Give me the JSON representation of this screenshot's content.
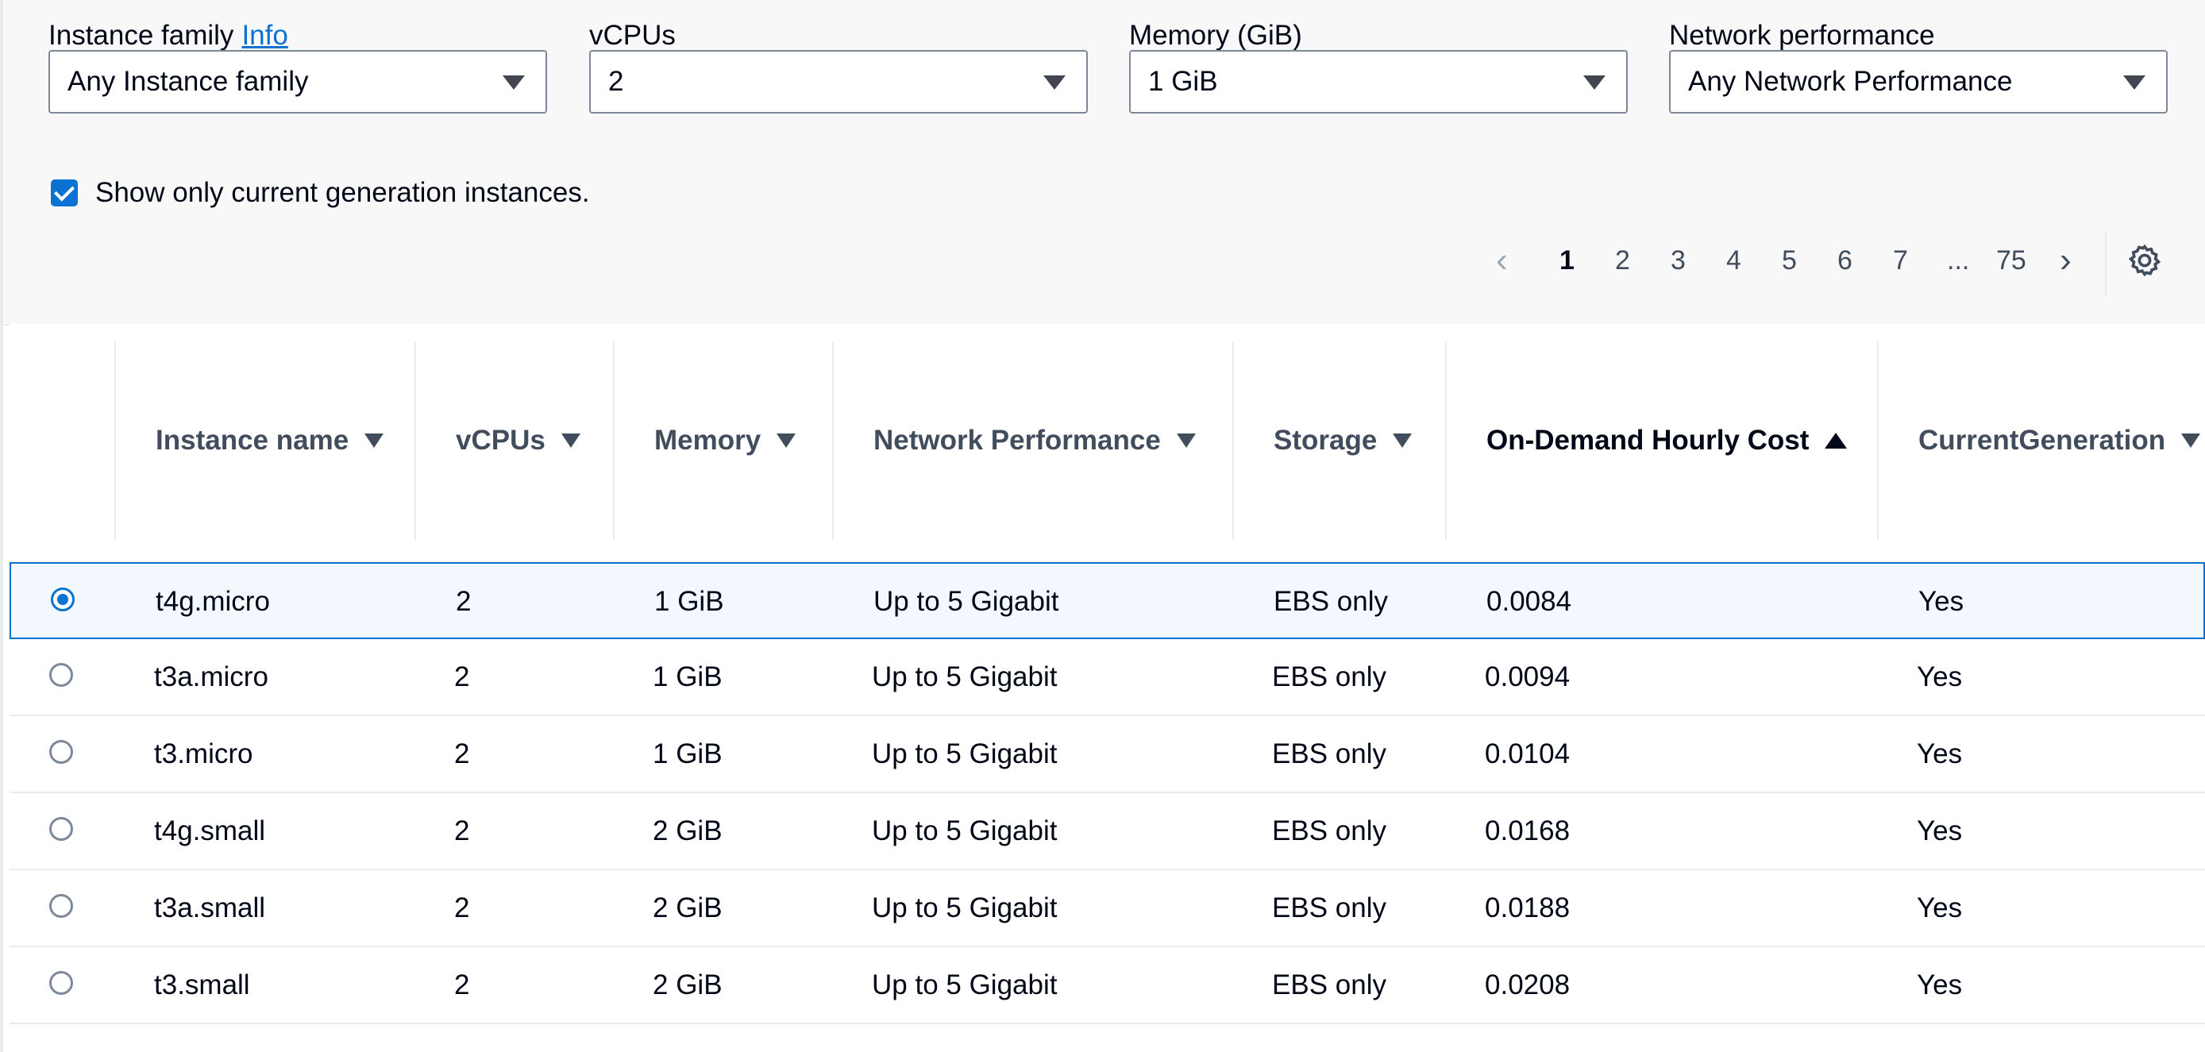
{
  "filters": {
    "instance_family": {
      "label": "Instance family",
      "info": "Info",
      "value": "Any Instance family"
    },
    "vcpus": {
      "label": "vCPUs",
      "value": "2"
    },
    "memory": {
      "label": "Memory (GiB)",
      "value": "1 GiB"
    },
    "network": {
      "label": "Network performance",
      "value": "Any Network Performance"
    }
  },
  "current_generation": {
    "label": "Show only current generation instances.",
    "checked": true
  },
  "pagination": {
    "current_page": "1",
    "pages": [
      "1",
      "2",
      "3",
      "4",
      "5",
      "6",
      "7"
    ],
    "ellipsis": "...",
    "last_page": "75",
    "prev_icon": "chevron-left-icon",
    "next_icon": "chevron-right-icon",
    "settings_icon": "gear-icon"
  },
  "table": {
    "columns": [
      {
        "label": "Instance name",
        "sort": "none"
      },
      {
        "label": "vCPUs",
        "sort": "none"
      },
      {
        "label": "Memory",
        "sort": "none"
      },
      {
        "label": "Network Performance",
        "sort": "none"
      },
      {
        "label": "Storage",
        "sort": "none"
      },
      {
        "label": "On-Demand Hourly Cost",
        "sort": "ascending"
      },
      {
        "label": "CurrentGeneration",
        "sort": "none"
      }
    ],
    "rows": [
      {
        "selected": true,
        "name": "t4g.micro",
        "vcpus": "2",
        "memory": "1 GiB",
        "network": "Up to 5 Gigabit",
        "storage": "EBS only",
        "cost": "0.0084",
        "current": "Yes"
      },
      {
        "selected": false,
        "name": "t3a.micro",
        "vcpus": "2",
        "memory": "1 GiB",
        "network": "Up to 5 Gigabit",
        "storage": "EBS only",
        "cost": "0.0094",
        "current": "Yes"
      },
      {
        "selected": false,
        "name": "t3.micro",
        "vcpus": "2",
        "memory": "1 GiB",
        "network": "Up to 5 Gigabit",
        "storage": "EBS only",
        "cost": "0.0104",
        "current": "Yes"
      },
      {
        "selected": false,
        "name": "t4g.small",
        "vcpus": "2",
        "memory": "2 GiB",
        "network": "Up to 5 Gigabit",
        "storage": "EBS only",
        "cost": "0.0168",
        "current": "Yes"
      },
      {
        "selected": false,
        "name": "t3a.small",
        "vcpus": "2",
        "memory": "2 GiB",
        "network": "Up to 5 Gigabit",
        "storage": "EBS only",
        "cost": "0.0188",
        "current": "Yes"
      },
      {
        "selected": false,
        "name": "t3.small",
        "vcpus": "2",
        "memory": "2 GiB",
        "network": "Up to 5 Gigabit",
        "storage": "EBS only",
        "cost": "0.0208",
        "current": "Yes"
      }
    ]
  },
  "colors": {
    "accent": "#0972d3",
    "border": "#7d8998",
    "text": "#000716",
    "muted": "#414d5c"
  }
}
